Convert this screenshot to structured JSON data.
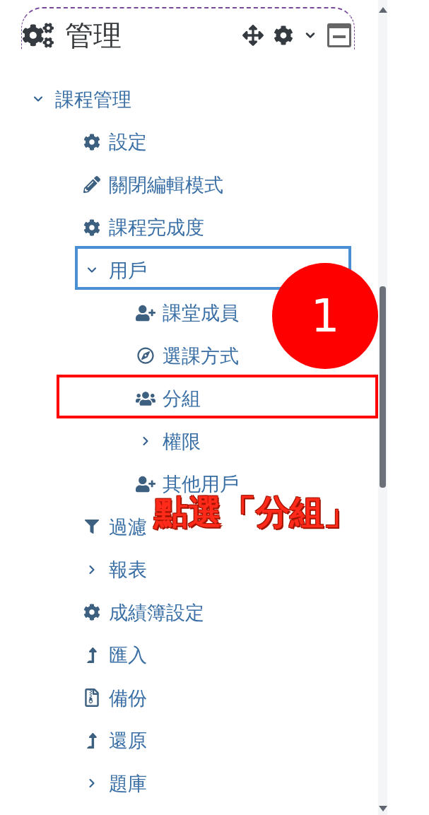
{
  "block": {
    "title": "管理"
  },
  "tree": [
    {
      "label": "課程管理",
      "kind": "branch",
      "expanded": true,
      "children": [
        {
          "label": "設定",
          "kind": "gear"
        },
        {
          "label": "關閉編輯模式",
          "kind": "pencil"
        },
        {
          "label": "課程完成度",
          "kind": "gear"
        },
        {
          "label": "用戶",
          "kind": "branch",
          "expanded": true,
          "color": "#4a8fd4",
          "children": [
            {
              "label": "課堂成員",
              "kind": "user-add"
            },
            {
              "label": "選課方式",
              "kind": "compass"
            },
            {
              "label": "分組",
              "kind": "users",
              "color": "#ff0000"
            },
            {
              "label": "權限",
              "kind": "branch",
              "expanded": false
            },
            {
              "label": "其他用戶",
              "kind": "user-add"
            }
          ]
        },
        {
          "label": "過濾",
          "kind": "filter"
        },
        {
          "label": "報表",
          "kind": "branch",
          "expanded": false
        },
        {
          "label": "成績簿設定",
          "kind": "gear"
        },
        {
          "label": "匯入",
          "kind": "upload"
        },
        {
          "label": "備份",
          "kind": "archive"
        },
        {
          "label": "還原",
          "kind": "upload"
        },
        {
          "label": "題庫",
          "kind": "branch",
          "expanded": false
        }
      ]
    }
  ],
  "annotation": {
    "step": "1",
    "caption": "點選「分組」"
  }
}
